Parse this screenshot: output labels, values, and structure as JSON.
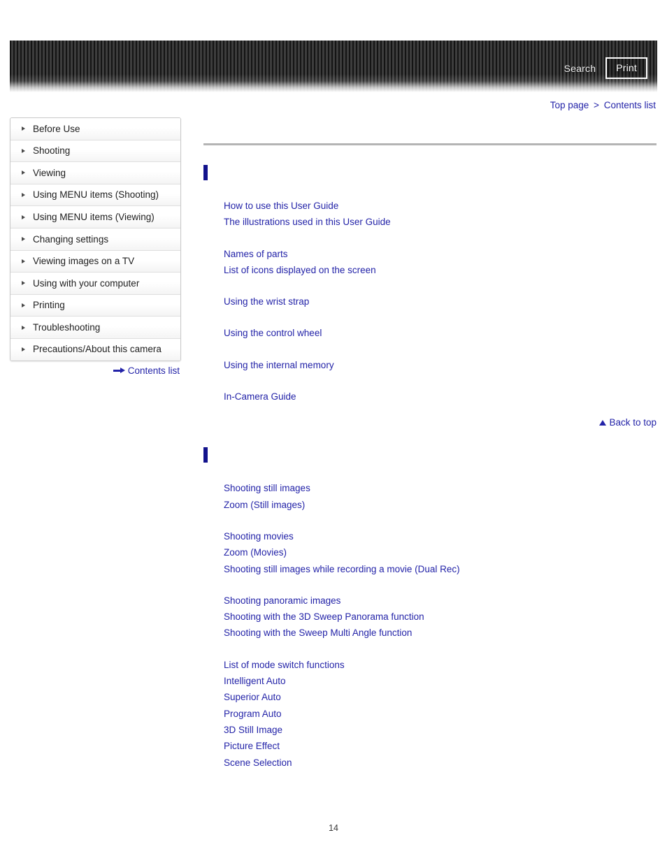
{
  "header": {
    "search_label": "Search",
    "print_label": "Print",
    "banner_dark_color": "#141414",
    "banner_stripe_color": "#3d3d3d"
  },
  "breadcrumb": {
    "items": [
      "Top page",
      "Contents list"
    ],
    "separator": ">"
  },
  "sidebar": {
    "items": [
      {
        "label": "Before Use",
        "icon": "triangle-right-icon"
      },
      {
        "label": "Shooting",
        "icon": "triangle-right-icon"
      },
      {
        "label": "Viewing",
        "icon": "triangle-right-icon"
      },
      {
        "label": "Using MENU items (Shooting)",
        "icon": "triangle-right-icon"
      },
      {
        "label": "Using MENU items (Viewing)",
        "icon": "triangle-right-icon"
      },
      {
        "label": "Changing settings",
        "icon": "triangle-right-icon"
      },
      {
        "label": "Viewing images on a TV",
        "icon": "triangle-right-icon"
      },
      {
        "label": "Using with your computer",
        "icon": "triangle-right-icon"
      },
      {
        "label": "Printing",
        "icon": "triangle-right-icon"
      },
      {
        "label": "Troubleshooting",
        "icon": "triangle-right-icon"
      },
      {
        "label": "Precautions/About this camera",
        "icon": "triangle-right-icon"
      }
    ],
    "contents_list_link": {
      "label": "Contents list",
      "icon": "arrow-right-icon"
    }
  },
  "main": {
    "link_color": "#2323a8",
    "section_bar_color": "#12128c",
    "sections": [
      {
        "title": "",
        "groups": [
          {
            "links": [
              "How to use this User Guide",
              "The illustrations used in this User Guide"
            ]
          },
          {
            "links": [
              "Names of parts",
              "List of icons displayed on the screen"
            ]
          },
          {
            "links": [
              "Using the wrist strap"
            ]
          },
          {
            "links": [
              "Using the control wheel"
            ]
          },
          {
            "links": [
              "Using the internal memory"
            ]
          },
          {
            "links": [
              "In-Camera Guide"
            ]
          }
        ],
        "back_to_top": {
          "label": "Back to top",
          "icon": "triangle-up-icon"
        }
      },
      {
        "title": "",
        "groups": [
          {
            "links": [
              "Shooting still images",
              "Zoom (Still images)"
            ]
          },
          {
            "links": [
              "Shooting movies",
              "Zoom (Movies)",
              "Shooting still images while recording a movie (Dual Rec)"
            ]
          },
          {
            "links": [
              "Shooting panoramic images",
              "Shooting with the 3D Sweep Panorama function",
              "Shooting with the Sweep Multi Angle function"
            ]
          },
          {
            "links": [
              "List of mode switch functions",
              "Intelligent Auto",
              "Superior Auto",
              "Program Auto",
              "3D Still Image",
              "Picture Effect",
              "Scene Selection"
            ]
          }
        ],
        "back_to_top": null
      }
    ]
  },
  "footer": {
    "page_number": "14"
  }
}
